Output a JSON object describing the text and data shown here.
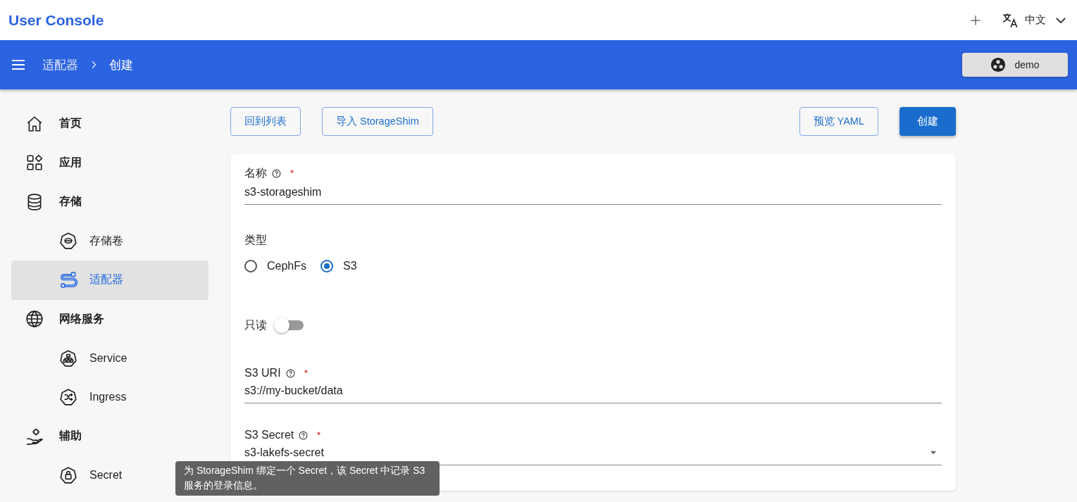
{
  "app": {
    "title": "User Console",
    "language": "中文"
  },
  "breadcrumb": [
    "适配器",
    "创建"
  ],
  "user": {
    "name": "demo"
  },
  "sidebar": {
    "items": [
      {
        "label": "首页",
        "selected": false
      },
      {
        "label": "应用",
        "selected": false
      },
      {
        "label": "存储",
        "selected": false,
        "children": [
          {
            "label": "存储卷",
            "selected": false
          },
          {
            "label": "适配器",
            "selected": true
          }
        ]
      },
      {
        "label": "网络服务",
        "selected": false,
        "children": [
          {
            "label": "Service",
            "selected": false
          },
          {
            "label": "Ingress",
            "selected": false
          }
        ]
      },
      {
        "label": "辅助",
        "selected": false,
        "children": [
          {
            "label": "Secret",
            "selected": false
          }
        ]
      }
    ]
  },
  "toolbar": {
    "left": [
      "回到列表",
      "导入 StorageShim"
    ],
    "right": [
      {
        "label": "预览 YAML",
        "primary": false
      },
      {
        "label": "创建",
        "primary": true
      }
    ]
  },
  "form": {
    "fields": [
      {
        "kind": "text",
        "label": "名称",
        "help": true,
        "required": true,
        "value": "s3-storageshim"
      },
      {
        "kind": "radio",
        "label": "类型",
        "options": [
          {
            "label": "CephFs",
            "selected": false
          },
          {
            "label": "S3",
            "selected": true
          }
        ]
      },
      {
        "kind": "switch",
        "label": "只读",
        "on": false
      },
      {
        "kind": "text",
        "label": "S3 URI",
        "help": true,
        "required": true,
        "value": "s3://my-bucket/data"
      },
      {
        "kind": "select",
        "label": "S3 Secret",
        "help": true,
        "required": true,
        "value": "s3-lakefs-secret"
      }
    ]
  },
  "tooltip": "为 StorageShim 绑定一个 Secret，该 Secret 中记录 S3 服务的登录信息。"
}
